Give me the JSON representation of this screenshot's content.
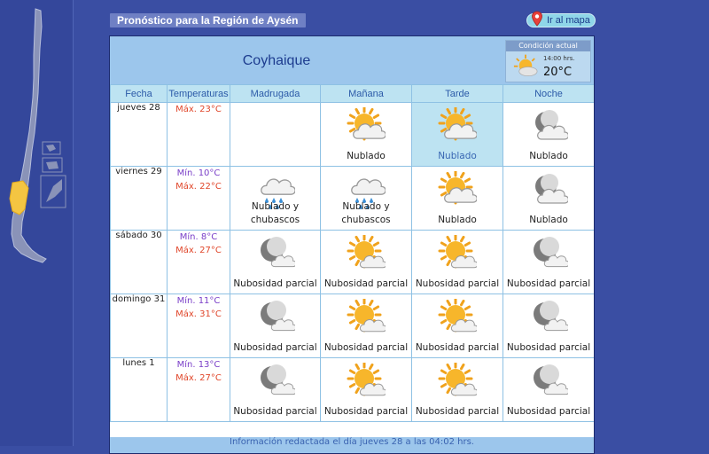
{
  "header": {
    "region_title": "Pronóstico para la Región de Aysén",
    "map_button": "Ir al mapa"
  },
  "city": "Coyhaique",
  "current": {
    "label": "Condición actual",
    "time": "14:00 hrs.",
    "temp": "20°C",
    "icon": "partly-cloudy-sun-icon"
  },
  "columns": [
    "Fecha",
    "Temperaturas",
    "Madrugada",
    "Mañana",
    "Tarde",
    "Noche"
  ],
  "days": [
    {
      "date": "jueves 28",
      "min": "",
      "max": "Máx. 23°C",
      "periods": [
        {
          "desc": "",
          "icon": ""
        },
        {
          "desc": "Nublado",
          "icon": "cloudy-sun-icon"
        },
        {
          "desc": "Nublado",
          "icon": "cloudy-sun-icon"
        },
        {
          "desc": "Nublado",
          "icon": "cloudy-moon-icon"
        }
      ]
    },
    {
      "date": "viernes 29",
      "min": "Mín. 10°C",
      "max": "Máx. 22°C",
      "periods": [
        {
          "desc": "Nublado y chubascos",
          "icon": "rain-showers-icon"
        },
        {
          "desc": "Nublado y chubascos",
          "icon": "rain-showers-icon"
        },
        {
          "desc": "Nublado",
          "icon": "cloudy-sun-icon"
        },
        {
          "desc": "Nublado",
          "icon": "cloudy-moon-icon"
        }
      ]
    },
    {
      "date": "sábado 30",
      "min": "Mín. 8°C",
      "max": "Máx. 27°C",
      "periods": [
        {
          "desc": "Nubosidad parcial",
          "icon": "partly-cloudy-moon-icon"
        },
        {
          "desc": "Nubosidad parcial",
          "icon": "partly-cloudy-sun-icon"
        },
        {
          "desc": "Nubosidad parcial",
          "icon": "partly-cloudy-sun-icon"
        },
        {
          "desc": "Nubosidad parcial",
          "icon": "partly-cloudy-moon-icon"
        }
      ]
    },
    {
      "date": "domingo 31",
      "min": "Mín. 11°C",
      "max": "Máx. 31°C",
      "periods": [
        {
          "desc": "Nubosidad parcial",
          "icon": "partly-cloudy-moon-icon"
        },
        {
          "desc": "Nubosidad parcial",
          "icon": "partly-cloudy-sun-icon"
        },
        {
          "desc": "Nubosidad parcial",
          "icon": "partly-cloudy-sun-icon"
        },
        {
          "desc": "Nubosidad parcial",
          "icon": "partly-cloudy-moon-icon"
        }
      ]
    },
    {
      "date": "lunes 1",
      "min": "Mín. 13°C",
      "max": "Máx. 27°C",
      "periods": [
        {
          "desc": "Nubosidad parcial",
          "icon": "partly-cloudy-moon-icon"
        },
        {
          "desc": "Nubosidad parcial",
          "icon": "partly-cloudy-sun-icon"
        },
        {
          "desc": "Nubosidad parcial",
          "icon": "partly-cloudy-sun-icon"
        },
        {
          "desc": "Nubosidad parcial",
          "icon": "partly-cloudy-moon-icon"
        }
      ]
    }
  ],
  "footer": "Información redactada el día jueves 28 a las 04:02 hrs.",
  "colors": {
    "background": "#3a4ea3",
    "header_bar": "#9cc6ec",
    "highlight_region": "#f4c542",
    "max_temp": "#e0462a",
    "min_temp": "#7a3fc8"
  }
}
